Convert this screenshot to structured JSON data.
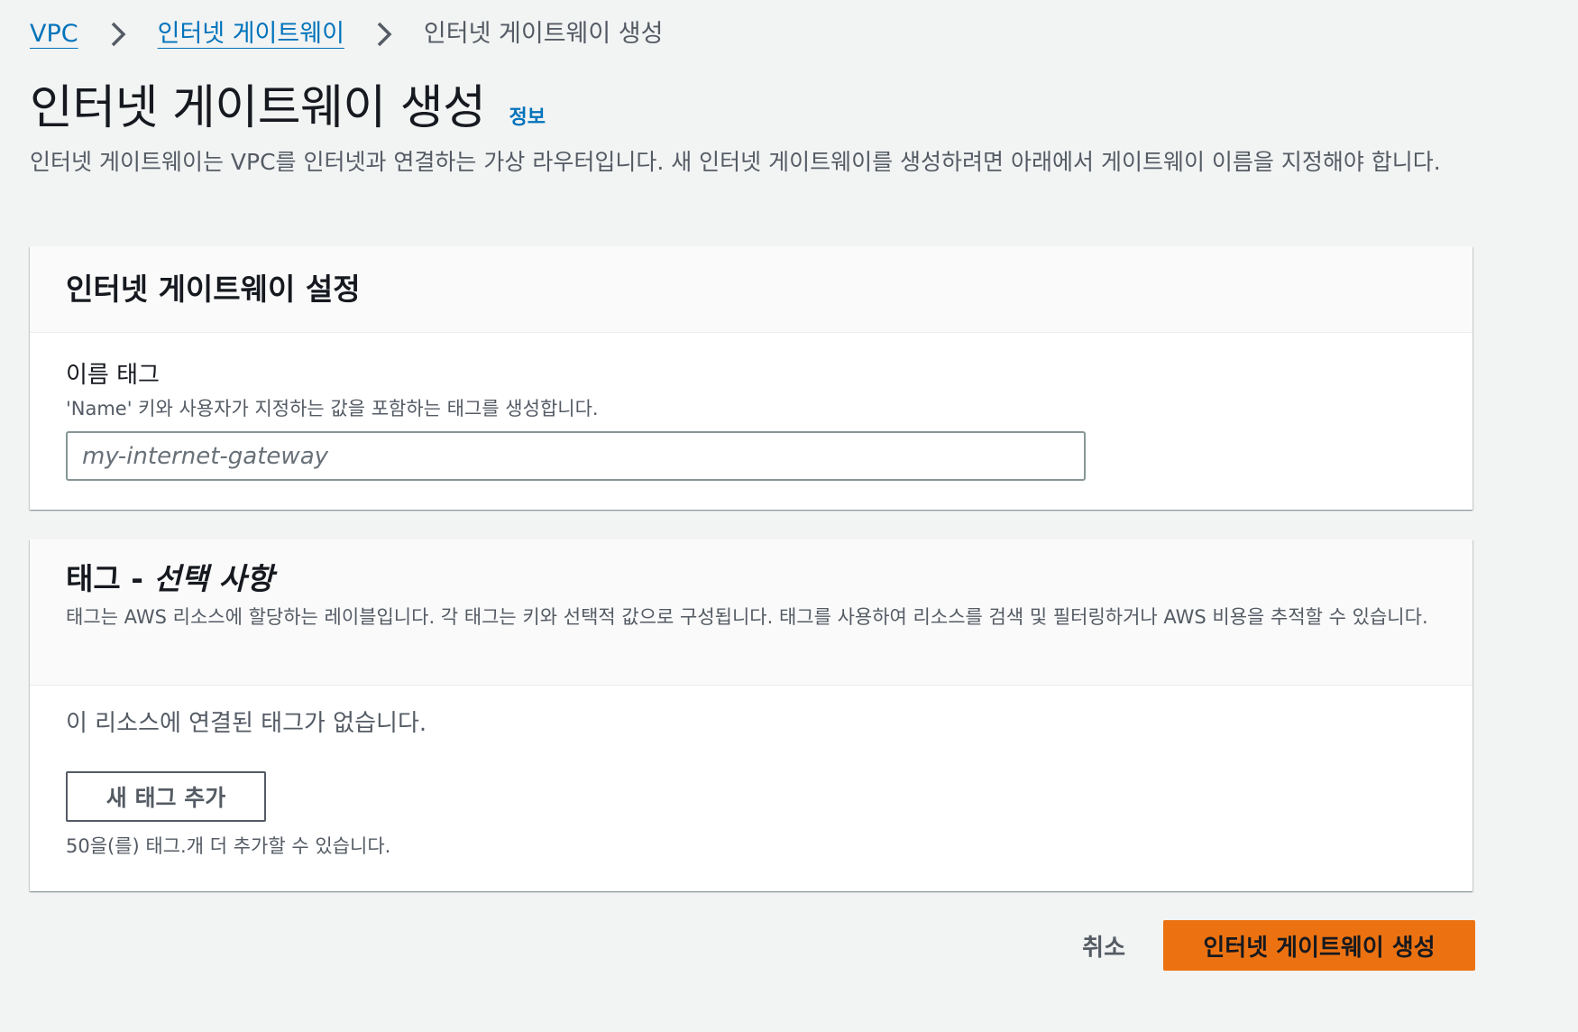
{
  "breadcrumb": {
    "items": [
      {
        "label": "VPC"
      },
      {
        "label": "인터넷 게이트웨이"
      },
      {
        "label": "인터넷 게이트웨이 생성"
      }
    ],
    "separator_icon": "chevron-right-icon"
  },
  "header": {
    "title": "인터넷 게이트웨이 생성",
    "info_label": "정보",
    "description": "인터넷 게이트웨이는 VPC를 인터넷과 연결하는 가상 라우터입니다. 새 인터넷 게이트웨이를 생성하려면 아래에서 게이트웨이 이름을 지정해야 합니다."
  },
  "settings_panel": {
    "title": "인터넷 게이트웨이 설정",
    "name_tag": {
      "label": "이름 태그",
      "description": "'Name' 키와 사용자가 지정하는 값을 포함하는 태그를 생성합니다.",
      "placeholder": "my-internet-gateway",
      "value": ""
    }
  },
  "tags_panel": {
    "title_main": "태그 - ",
    "title_optional": "선택 사항",
    "description": "태그는 AWS 리소스에 할당하는 레이블입니다. 각 태그는 키와 선택적 값으로 구성됩니다. 태그를 사용하여 리소스를 검색 및 필터링하거나 AWS 비용을 추적할 수 있습니다.",
    "empty_message": "이 리소스에 연결된 태그가 없습니다.",
    "add_tag_label": "새 태그 추가",
    "limit_message": "50을(를) 태그.개 더 추가할 수 있습니다."
  },
  "actions": {
    "cancel_label": "취소",
    "submit_label": "인터넷 게이트웨이 생성"
  },
  "colors": {
    "background": "#f2f3f3",
    "link": "#0073bb",
    "primary": "#ec7211",
    "text_secondary": "#545b64",
    "border_input": "#879596"
  }
}
